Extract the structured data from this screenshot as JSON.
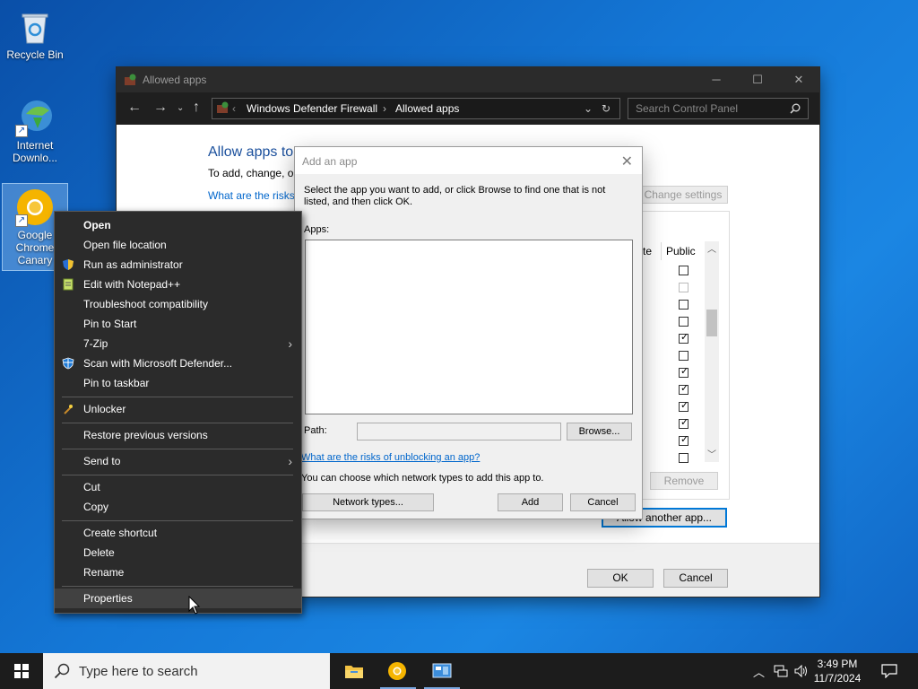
{
  "desktop": {
    "icons": [
      {
        "label": "Recycle Bin"
      },
      {
        "label": "Internet Downlo..."
      },
      {
        "label": "Google Chrome Canary"
      }
    ]
  },
  "window": {
    "title": "Allowed apps",
    "breadcrumb": [
      "Windows Defender Firewall",
      "Allowed apps"
    ],
    "search_placeholder": "Search Control Panel",
    "heading": "Allow apps to",
    "subtext": "To add, change, or",
    "risk_link": "What are the risks",
    "change_settings": "Change settings",
    "col_private_fragment": "te",
    "col_public": "Public",
    "public_checks": [
      false,
      false,
      false,
      false,
      true,
      false,
      true,
      true,
      true,
      true,
      true,
      false
    ],
    "remove_button": "Remove",
    "allow_another_button": "Allow another app...",
    "ok_button": "OK",
    "cancel_button": "Cancel"
  },
  "dialog": {
    "title": "Add an app",
    "instructions_line1": "Select the app you want to add, or click Browse to find one that is not",
    "instructions_line2": "listed, and then click OK.",
    "apps_label": "Apps:",
    "path_label": "Path:",
    "path_value": "",
    "browse_button": "Browse...",
    "risk_link": "What are the risks of unblocking an app?",
    "network_note": "You can choose which network types to add this app to.",
    "network_types_button": "Network types...",
    "add_button": "Add",
    "cancel_button": "Cancel"
  },
  "context_menu": {
    "items": [
      {
        "label": "Open"
      },
      {
        "label": "Open file location"
      },
      {
        "label": "Run as administrator"
      },
      {
        "label": "Edit with Notepad++"
      },
      {
        "label": "Troubleshoot compatibility"
      },
      {
        "label": "Pin to Start"
      },
      {
        "label": "7-Zip"
      },
      {
        "label": "Scan with Microsoft Defender..."
      },
      {
        "label": "Pin to taskbar"
      },
      {
        "label": "Unlocker"
      },
      {
        "label": "Restore previous versions"
      },
      {
        "label": "Send to"
      },
      {
        "label": "Cut"
      },
      {
        "label": "Copy"
      },
      {
        "label": "Create shortcut"
      },
      {
        "label": "Delete"
      },
      {
        "label": "Rename"
      },
      {
        "label": "Properties"
      }
    ]
  },
  "taskbar": {
    "search_placeholder": "Type here to search",
    "time": "3:49 PM",
    "date": "11/7/2024"
  }
}
